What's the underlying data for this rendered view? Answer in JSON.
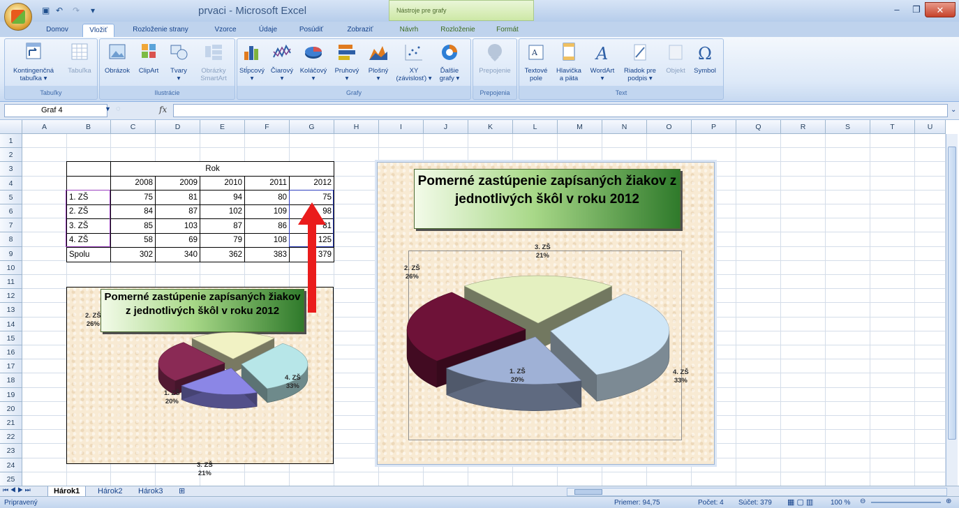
{
  "window": {
    "title": "prvaci - Microsoft Excel",
    "context_tools": "Nástroje pre grafy"
  },
  "tabs": [
    {
      "label": "Domov"
    },
    {
      "label": "Vložiť"
    },
    {
      "label": "Rozloženie strany"
    },
    {
      "label": "Vzorce"
    },
    {
      "label": "Údaje"
    },
    {
      "label": "Posúdiť"
    },
    {
      "label": "Zobraziť"
    },
    {
      "label": "Návrh"
    },
    {
      "label": "Rozloženie"
    },
    {
      "label": "Formát"
    }
  ],
  "ribbon": {
    "groups": [
      {
        "label": "Tabuľky"
      },
      {
        "label": "Ilustrácie"
      },
      {
        "label": "Grafy"
      },
      {
        "label": "Prepojenia"
      },
      {
        "label": "Text"
      }
    ],
    "buttons": [
      {
        "label": "Kontingenčná",
        "label2": "tabuľka ▾"
      },
      {
        "label": "Tabuľka",
        "label2": ""
      },
      {
        "label": "Obrázok",
        "label2": ""
      },
      {
        "label": "ClipArt",
        "label2": ""
      },
      {
        "label": "Tvary",
        "label2": "▾"
      },
      {
        "label": "Obrázky",
        "label2": "SmartArt"
      },
      {
        "label": "Stĺpcový",
        "label2": "▾"
      },
      {
        "label": "Čiarový",
        "label2": "▾"
      },
      {
        "label": "Koláčový",
        "label2": "▾"
      },
      {
        "label": "Pruhový",
        "label2": "▾"
      },
      {
        "label": "Plošný",
        "label2": "▾"
      },
      {
        "label": "XY",
        "label2": "(závislosť) ▾"
      },
      {
        "label": "Ďalšie",
        "label2": "grafy ▾"
      },
      {
        "label": "Prepojenie",
        "label2": ""
      },
      {
        "label": "Textové",
        "label2": "pole"
      },
      {
        "label": "Hlavička",
        "label2": "a päta"
      },
      {
        "label": "WordArt",
        "label2": "▾"
      },
      {
        "label": "Riadok pre",
        "label2": "podpis ▾"
      },
      {
        "label": "Objekt",
        "label2": ""
      },
      {
        "label": "Symbol",
        "label2": ""
      }
    ]
  },
  "formula_bar": {
    "name_box": "Graf 4",
    "fx": "fx",
    "value": ""
  },
  "columns": [
    "A",
    "B",
    "C",
    "D",
    "E",
    "F",
    "G",
    "H",
    "I",
    "J",
    "K",
    "L",
    "M",
    "N",
    "O",
    "P",
    "Q",
    "R",
    "S",
    "T",
    "U"
  ],
  "rows": [
    "1",
    "2",
    "3",
    "4",
    "5",
    "6",
    "7",
    "8",
    "9",
    "10",
    "11",
    "12",
    "13",
    "14",
    "15",
    "16",
    "17",
    "18",
    "19",
    "20",
    "21",
    "22",
    "23",
    "24",
    "25"
  ],
  "table": {
    "header_group": "Rok",
    "years": [
      "2008",
      "2009",
      "2010",
      "2011",
      "2012"
    ],
    "rows": [
      {
        "label": "1. ZŠ",
        "values": [
          "75",
          "81",
          "94",
          "80",
          "75"
        ]
      },
      {
        "label": "2. ZŠ",
        "values": [
          "84",
          "87",
          "102",
          "109",
          "98"
        ]
      },
      {
        "label": "3. ZŠ",
        "values": [
          "85",
          "103",
          "87",
          "86",
          "81"
        ]
      },
      {
        "label": "4. ZŠ",
        "values": [
          "58",
          "69",
          "79",
          "108",
          "125"
        ]
      },
      {
        "label": "Spolu",
        "values": [
          "302",
          "340",
          "362",
          "383",
          "379"
        ]
      }
    ]
  },
  "chart_data": [
    {
      "type": "pie",
      "title": "Pomerné zastúpenie zapísaných žiakov z jednotlivých škôl v roku 2012",
      "categories": [
        "1. ZŠ",
        "2. ZŠ",
        "3. ZŠ",
        "4. ZŠ"
      ],
      "values": [
        75,
        98,
        81,
        125
      ],
      "labels": [
        "20%",
        "26%",
        "21%",
        "33%"
      ],
      "colors": [
        "#8b86e6",
        "#8a2a55",
        "#f1f2c4",
        "#b7e6e8"
      ]
    },
    {
      "type": "pie",
      "title": "Pomerné zastúpenie zapísaných žiakov z jednotlivých škôl v roku 2012",
      "categories": [
        "1. ZŠ",
        "2. ZŠ",
        "3. ZŠ",
        "4. ZŠ"
      ],
      "values": [
        75,
        98,
        81,
        125
      ],
      "labels": [
        "20%",
        "26%",
        "21%",
        "33%"
      ],
      "colors": [
        "#9fb1d6",
        "#6e1238",
        "#e4f0c0",
        "#cfe6f7"
      ]
    }
  ],
  "sheets": [
    "Hárok1",
    "Hárok2",
    "Hárok3"
  ],
  "status": {
    "ready": "Pripravený",
    "average": "Priemer: 94,75",
    "count": "Počet: 4",
    "sum": "Súčet: 379",
    "zoom": "100 %"
  }
}
